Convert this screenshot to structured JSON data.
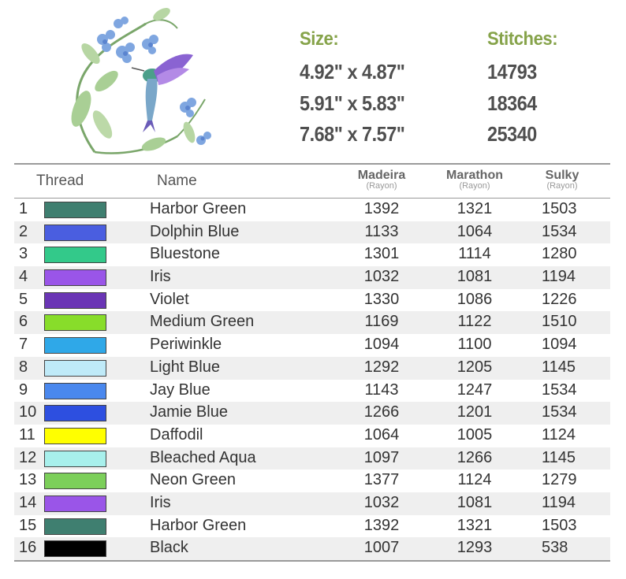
{
  "specs": {
    "size_header": "Size:",
    "stitches_header": "Stitches:",
    "sizes": [
      "4.92\" x 4.87\"",
      "5.91\" x 5.83\"",
      "7.68\" x 7.57\""
    ],
    "stitches": [
      "14793",
      "18364",
      "25340"
    ]
  },
  "table": {
    "headers": {
      "thread": "Thread",
      "name": "Name",
      "madeira": "Madeira",
      "madeira_sub": "(Rayon)",
      "marathon": "Marathon",
      "marathon_sub": "(Rayon)",
      "sulky": "Sulky",
      "sulky_sub": "(Rayon)"
    },
    "rows": [
      {
        "num": "1",
        "color": "#3f7f70",
        "name": "Harbor Green",
        "madeira": "1392",
        "marathon": "1321",
        "sulky": "1503"
      },
      {
        "num": "2",
        "color": "#4a5ee0",
        "name": "Dolphin Blue",
        "madeira": "1133",
        "marathon": "1064",
        "sulky": "1534"
      },
      {
        "num": "3",
        "color": "#33c98a",
        "name": "Bluestone",
        "madeira": "1301",
        "marathon": "1114",
        "sulky": "1280"
      },
      {
        "num": "4",
        "color": "#9a55e8",
        "name": "Iris",
        "madeira": "1032",
        "marathon": "1081",
        "sulky": "1194"
      },
      {
        "num": "5",
        "color": "#6a35b5",
        "name": "Violet",
        "madeira": "1330",
        "marathon": "1086",
        "sulky": "1226"
      },
      {
        "num": "6",
        "color": "#88dd2a",
        "name": "Medium Green",
        "madeira": "1169",
        "marathon": "1122",
        "sulky": "1510"
      },
      {
        "num": "7",
        "color": "#2fa8e8",
        "name": "Periwinkle",
        "madeira": "1094",
        "marathon": "1100",
        "sulky": "1094"
      },
      {
        "num": "8",
        "color": "#bfeaf8",
        "name": "Light Blue",
        "madeira": "1292",
        "marathon": "1205",
        "sulky": "1145"
      },
      {
        "num": "9",
        "color": "#4a88ee",
        "name": "Jay Blue",
        "madeira": "1143",
        "marathon": "1247",
        "sulky": "1534"
      },
      {
        "num": "10",
        "color": "#2d4fe0",
        "name": "Jamie Blue",
        "madeira": "1266",
        "marathon": "1201",
        "sulky": "1534"
      },
      {
        "num": "11",
        "color": "#ffff00",
        "name": "Daffodil",
        "madeira": "1064",
        "marathon": "1005",
        "sulky": "1124"
      },
      {
        "num": "12",
        "color": "#a8f0ec",
        "name": "Bleached Aqua",
        "madeira": "1097",
        "marathon": "1266",
        "sulky": "1145"
      },
      {
        "num": "13",
        "color": "#7ccf5a",
        "name": "Neon Green",
        "madeira": "1377",
        "marathon": "1124",
        "sulky": "1279"
      },
      {
        "num": "14",
        "color": "#9a55e8",
        "name": "Iris",
        "madeira": "1032",
        "marathon": "1081",
        "sulky": "1194"
      },
      {
        "num": "15",
        "color": "#3f7f70",
        "name": "Harbor Green",
        "madeira": "1392",
        "marathon": "1321",
        "sulky": "1503"
      },
      {
        "num": "16",
        "color": "#000000",
        "name": "Black",
        "madeira": "1007",
        "marathon": "1293",
        "sulky": "538"
      }
    ]
  }
}
